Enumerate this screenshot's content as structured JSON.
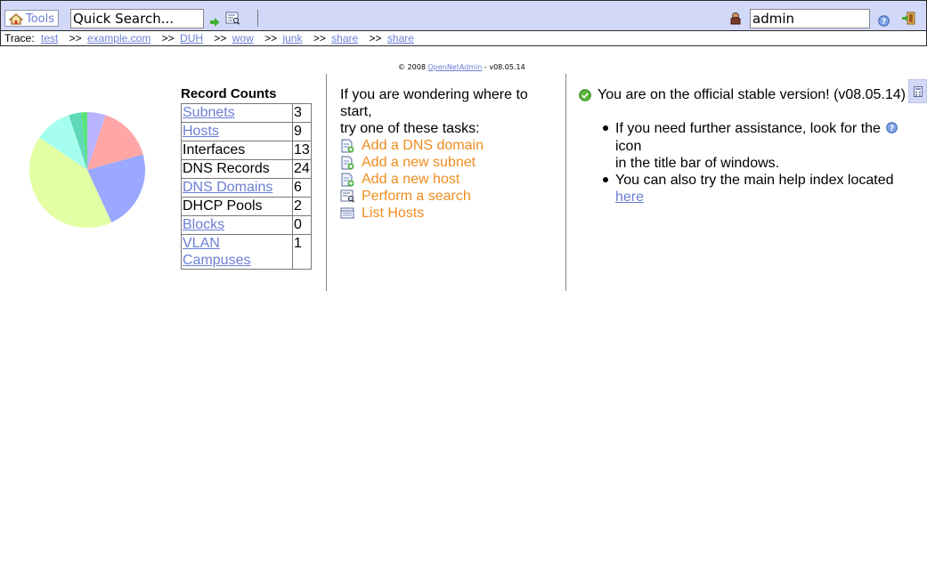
{
  "toolbar": {
    "tools_label": "Tools",
    "quick_search_value": "Quick Search...",
    "login_value": "admin"
  },
  "trace": {
    "label": "Trace:",
    "separator": ">>",
    "items": [
      "test",
      "example.com",
      "DUH",
      "wow",
      "junk",
      "share",
      "share"
    ]
  },
  "footer": {
    "copyright_prefix": "© 2008",
    "product_link": "OpenNetAdmin",
    "version_suffix": "- v08.05.14"
  },
  "record_counts": {
    "title": "Record Counts",
    "rows": [
      {
        "name": "Subnets",
        "count": "3",
        "link": true
      },
      {
        "name": "Hosts",
        "count": "9",
        "link": true
      },
      {
        "name": "Interfaces",
        "count": "13",
        "link": false
      },
      {
        "name": "DNS Records",
        "count": "24",
        "link": false
      },
      {
        "name": "DNS Domains",
        "count": "6",
        "link": true
      },
      {
        "name": "DHCP Pools",
        "count": "2",
        "link": false
      },
      {
        "name": "Blocks",
        "count": "0",
        "link": true
      },
      {
        "name": "VLAN Campuses",
        "count": "1",
        "link": true
      }
    ]
  },
  "pie": {
    "values": [
      3,
      9,
      13,
      24,
      6,
      2,
      0,
      1
    ],
    "colors": [
      "#b9b4ff",
      "#ffa6a6",
      "#9aa8ff",
      "#e2ffa4",
      "#a6ffee",
      "#5ed8b6",
      "#a8a8ff",
      "#58e47a"
    ]
  },
  "getting_started": {
    "intro_line1": "If you are wondering where to start,",
    "intro_line2": "try one of these tasks:",
    "tasks": [
      {
        "label": "Add a DNS domain",
        "icon": "add-domain-icon"
      },
      {
        "label": "Add a new subnet",
        "icon": "add-subnet-icon"
      },
      {
        "label": "Add a new host",
        "icon": "add-host-icon"
      },
      {
        "label": "Perform a search",
        "icon": "search-icon"
      },
      {
        "label": "List Hosts",
        "icon": "list-hosts-icon"
      }
    ]
  },
  "version_info": {
    "message": "You are on the official stable version! (v08.05.14)",
    "help1_before": "If you need further assistance, look for the",
    "help1_after": "icon",
    "help1_line2": "in the title bar of windows.",
    "help2_text": "You can also try the main help index located",
    "help2_link": "here"
  },
  "colors": {
    "toolbar_bg": "#d2d8f7",
    "link": "#6a7fd6",
    "task_link": "#f08c1e"
  }
}
